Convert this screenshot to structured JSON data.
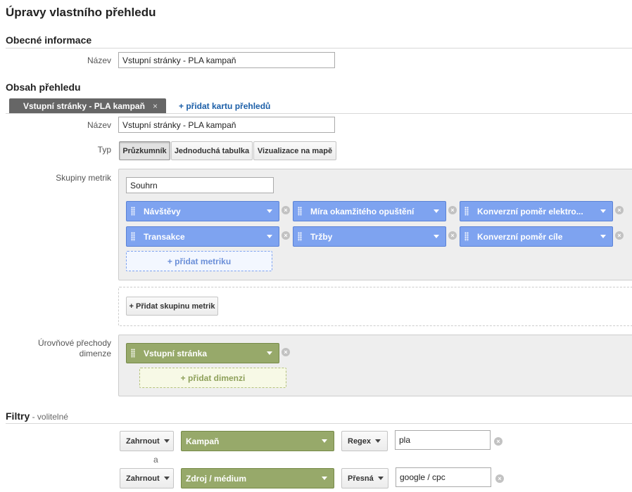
{
  "page_title": "Úpravy vlastního přehledu",
  "general": {
    "heading": "Obecné informace",
    "name_label": "Název",
    "name_value": "Vstupní stránky - PLA kampaň"
  },
  "content": {
    "heading": "Obsah přehledu",
    "tab_label": "Vstupní stránky - PLA kampaň",
    "tab_close": "×",
    "add_tab": "+ přidat kartu přehledů",
    "name_label": "Název",
    "name_value": "Vstupní stránky - PLA kampaň",
    "type_label": "Typ",
    "types": [
      "Průzkumník",
      "Jednoduchá tabulka",
      "Vizualizace na mapě"
    ],
    "selected_type": "Průzkumník"
  },
  "metrics": {
    "label": "Skupiny metrik",
    "group_name": "Souhrn",
    "items": [
      "Návštěvy",
      "Míra okamžitého opuštění",
      "Konverzní poměr elektro...",
      "Transakce",
      "Tržby",
      "Konverzní poměr cíle"
    ],
    "add_metric": "+ přidat metriku",
    "add_group": "+ Přidat skupinu metrik",
    "remove_glyph": "×",
    "chip_color": "#7ea3f0"
  },
  "dimensions": {
    "label_line1": "Úrovňové přechody",
    "label_line2": "dimenze",
    "items": [
      "Vstupní stránka"
    ],
    "add_dimension": "+ přidat dimenzi",
    "chip_color": "#97a96a"
  },
  "filters": {
    "heading": "Filtry",
    "optional": " - volitelné",
    "connector": "a",
    "rows": [
      {
        "include": "Zahrnout",
        "dimension": "Kampaň",
        "match": "Regex",
        "value": "pla"
      },
      {
        "include": "Zahrnout",
        "dimension": "Zdroj / médium",
        "match": "Přesná",
        "value": "google / cpc"
      }
    ]
  }
}
